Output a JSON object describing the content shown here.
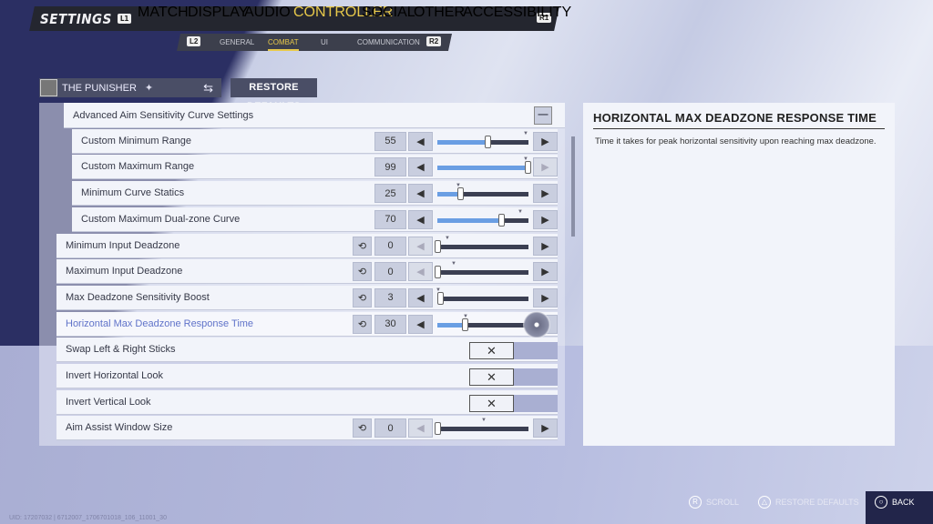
{
  "header": {
    "title": "SETTINGS",
    "left_bumper": "L1",
    "right_bumper": "R1",
    "tabs": [
      {
        "label": "MATCH"
      },
      {
        "label": "DISPLAY"
      },
      {
        "label": "AUDIO"
      },
      {
        "label": "CONTROLLER",
        "active": true
      },
      {
        "label": "SOCIAL"
      },
      {
        "label": "OTHER"
      },
      {
        "label": "ACCESSIBILITY"
      }
    ],
    "subtabs": {
      "left_trigger": "L2",
      "right_trigger": "R2",
      "items": [
        {
          "label": "GENERAL"
        },
        {
          "label": "COMBAT",
          "active": true
        },
        {
          "label": "UI"
        },
        {
          "label": "COMMUNICATION"
        }
      ]
    }
  },
  "character": {
    "name": "THE PUNISHER",
    "swap_icon": "swap-arrows-icon"
  },
  "restore_defaults": "RESTORE DEFAULTS",
  "section": {
    "label": "Advanced Aim Sensitivity Curve Settings",
    "collapse_icon": "minus-icon"
  },
  "settings": [
    {
      "label": "Custom Minimum Range",
      "type": "slider",
      "value": 55,
      "fraction": 0.55,
      "sub": true,
      "reset": false,
      "default": 0.96
    },
    {
      "label": "Custom Maximum Range",
      "type": "slider",
      "value": 99,
      "fraction": 0.99,
      "sub": true,
      "reset": false,
      "default": 0.96,
      "right_disabled": true
    },
    {
      "label": "Minimum Curve Statics",
      "type": "slider",
      "value": 25,
      "fraction": 0.25,
      "sub": true,
      "reset": false,
      "default": 0.22
    },
    {
      "label": "Custom Maximum Dual-zone Curve",
      "type": "slider",
      "value": 70,
      "fraction": 0.7,
      "sub": true,
      "reset": false,
      "default": 0.9
    },
    {
      "label": "Minimum Input Deadzone",
      "type": "slider",
      "value": 0,
      "fraction": 0,
      "reset": true,
      "default": 0.1,
      "left_disabled": true
    },
    {
      "label": "Maximum Input Deadzone",
      "type": "slider",
      "value": 0,
      "fraction": 0,
      "reset": true,
      "default": 0.17,
      "left_disabled": true
    },
    {
      "label": "Max Deadzone Sensitivity Boost",
      "type": "slider",
      "value": 3,
      "fraction": 0.03,
      "reset": true,
      "default": 0
    },
    {
      "label": "Horizontal Max Deadzone Response Time",
      "type": "slider",
      "value": 30,
      "fraction": 0.3,
      "reset": true,
      "default": 0.3,
      "selected": true
    },
    {
      "label": "Swap Left & Right Sticks",
      "type": "toggle",
      "value": "✕"
    },
    {
      "label": "Invert Horizontal Look",
      "type": "toggle",
      "value": "✕"
    },
    {
      "label": "Invert Vertical Look",
      "type": "toggle",
      "value": "✕"
    },
    {
      "label": "Aim Assist Window Size",
      "type": "slider",
      "value": 0,
      "fraction": 0,
      "reset": true,
      "default": 0.5,
      "left_disabled": true
    }
  ],
  "description": {
    "title": "HORIZONTAL MAX DEADZONE RESPONSE TIME",
    "text": "Time it takes for peak horizontal sensitivity upon reaching max deadzone."
  },
  "footer": {
    "scroll": "SCROLL",
    "scroll_button": "R",
    "restore": "RESTORE DEFAULTS",
    "restore_button": "△",
    "back": "BACK",
    "back_button": "○",
    "uid": "UID: 17207032 | 6712007_1706701018_106_11001_30"
  },
  "colors": {
    "accent": "#e8c94a",
    "slider_fill": "#6a9ee3",
    "selected_text": "#6073c9"
  }
}
